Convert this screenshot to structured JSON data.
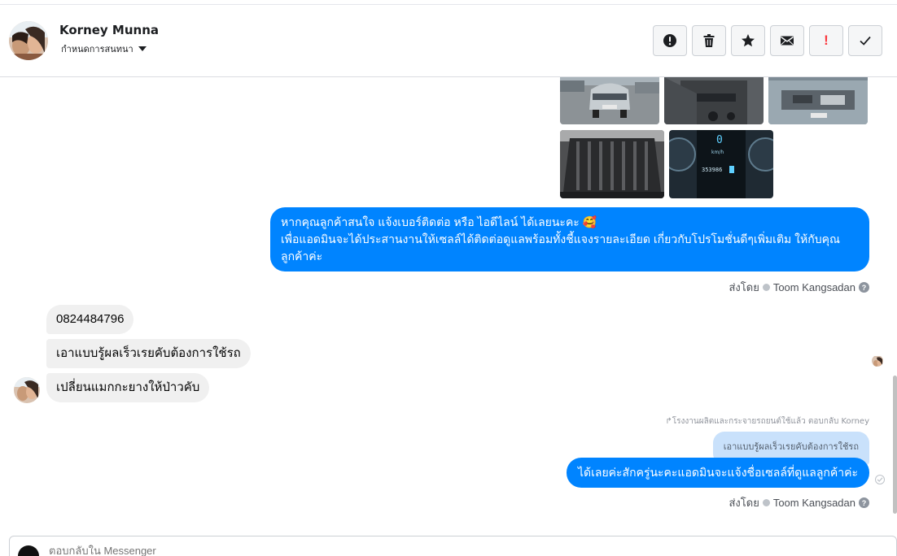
{
  "header": {
    "contact_name": "Korney Munna",
    "assign_label": "กำหนดการสนทนา",
    "actions": [
      {
        "name": "spam",
        "icon": "exclamation-circle-icon"
      },
      {
        "name": "delete",
        "icon": "trash-icon"
      },
      {
        "name": "star",
        "icon": "star-icon"
      },
      {
        "name": "unread",
        "icon": "envelope-icon"
      },
      {
        "name": "important",
        "icon": "red-exclamation-icon"
      },
      {
        "name": "done",
        "icon": "checkmark-icon"
      }
    ]
  },
  "thread": {
    "outgoing_promo": "หากคุณลูกค้าสนใจ แจ้งเบอร์ติดต่อ หรือ ไอดีไลน์ ได้เลยนะคะ 🥰\nเพื่อแอดมินจะได้ประสานงานให้เซลล์ได้ติดต่อดูแลพร้อมทั้งชี้แจงรายละเอียด เกี่ยวกับโปรโมชั่นดีๆเพิ่มเติม ให้กับคุณลูกค้าค่ะ",
    "sent_by_prefix": "ส่งโดย",
    "sent_by_name": "Toom Kangsadan",
    "incoming": [
      "0824484796",
      "เอาแบบรู้ผลเร็วเรยคับต้องการใช้รถ",
      "เปลี่ยนแมกกะยางให้ป่าวคับ"
    ],
    "reply_note": "โรงงานผลิตและกระจายรถยนต์ใช้แล้ว ตอบกลับ Korney",
    "quoted_text": "เอาแบบรู้ผลเร็วเรยคับต้องการใช้รถ",
    "outgoing_reply": "ได้เลยค่ะสักครู่นะคะแอดมินจะแจ้งชื่อเซลล์ที่ดูแลลูกค้าค่ะ",
    "photo_speed_value": "0",
    "photo_speed_unit": "km/h",
    "photo_odometer": "353986"
  },
  "composer": {
    "placeholder": "ตอบกลับใน Messenger"
  },
  "colors": {
    "outgoing_bubble": "#0084ff",
    "incoming_bubble": "#f0f0f0",
    "quote_bubble": "#c9e1fb",
    "important_red": "#fa383e"
  }
}
